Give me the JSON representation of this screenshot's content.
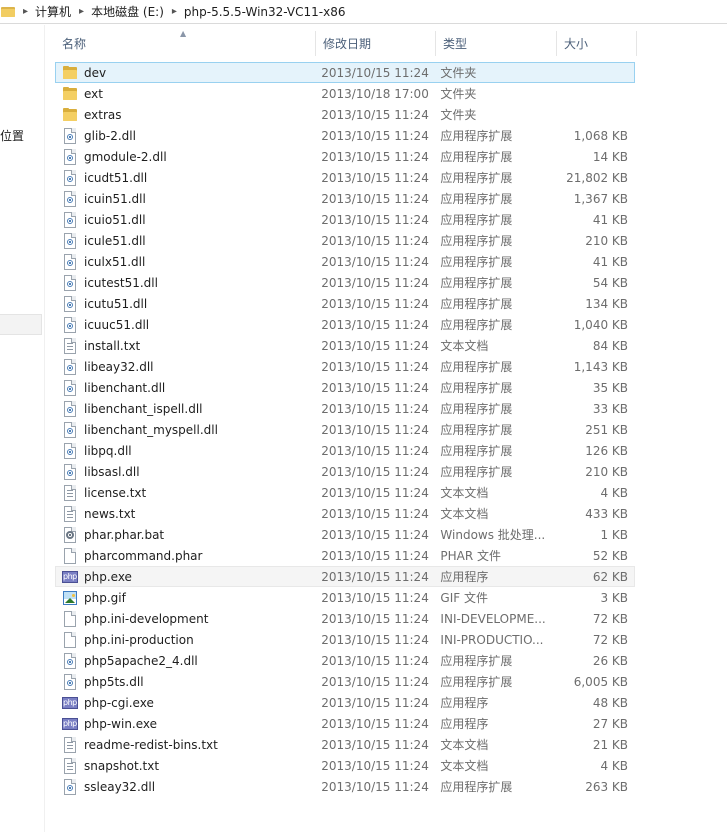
{
  "address_bar": {
    "crumbs": [
      "计算机",
      "本地磁盘 (E:)",
      "php-5.5.5-Win32-VC11-x86"
    ]
  },
  "nav_pane": {
    "partial_label": "位置"
  },
  "columns": {
    "name": "名称",
    "date": "修改日期",
    "type": "类型",
    "size": "大小"
  },
  "files": [
    {
      "name": "dev",
      "date": "2013/10/15 11:24",
      "type": "文件夹",
      "size": "",
      "icon": "folder-icon"
    },
    {
      "name": "ext",
      "date": "2013/10/18 17:00",
      "type": "文件夹",
      "size": "",
      "icon": "folder-icon"
    },
    {
      "name": "extras",
      "date": "2013/10/15 11:24",
      "type": "文件夹",
      "size": "",
      "icon": "folder-icon"
    },
    {
      "name": "glib-2.dll",
      "date": "2013/10/15 11:24",
      "type": "应用程序扩展",
      "size": "1,068 KB",
      "icon": "dll-icon"
    },
    {
      "name": "gmodule-2.dll",
      "date": "2013/10/15 11:24",
      "type": "应用程序扩展",
      "size": "14 KB",
      "icon": "dll-icon"
    },
    {
      "name": "icudt51.dll",
      "date": "2013/10/15 11:24",
      "type": "应用程序扩展",
      "size": "21,802 KB",
      "icon": "dll-icon"
    },
    {
      "name": "icuin51.dll",
      "date": "2013/10/15 11:24",
      "type": "应用程序扩展",
      "size": "1,367 KB",
      "icon": "dll-icon"
    },
    {
      "name": "icuio51.dll",
      "date": "2013/10/15 11:24",
      "type": "应用程序扩展",
      "size": "41 KB",
      "icon": "dll-icon"
    },
    {
      "name": "icule51.dll",
      "date": "2013/10/15 11:24",
      "type": "应用程序扩展",
      "size": "210 KB",
      "icon": "dll-icon"
    },
    {
      "name": "iculx51.dll",
      "date": "2013/10/15 11:24",
      "type": "应用程序扩展",
      "size": "41 KB",
      "icon": "dll-icon"
    },
    {
      "name": "icutest51.dll",
      "date": "2013/10/15 11:24",
      "type": "应用程序扩展",
      "size": "54 KB",
      "icon": "dll-icon"
    },
    {
      "name": "icutu51.dll",
      "date": "2013/10/15 11:24",
      "type": "应用程序扩展",
      "size": "134 KB",
      "icon": "dll-icon"
    },
    {
      "name": "icuuc51.dll",
      "date": "2013/10/15 11:24",
      "type": "应用程序扩展",
      "size": "1,040 KB",
      "icon": "dll-icon"
    },
    {
      "name": "install.txt",
      "date": "2013/10/15 11:24",
      "type": "文本文档",
      "size": "84 KB",
      "icon": "text-file-icon"
    },
    {
      "name": "libeay32.dll",
      "date": "2013/10/15 11:24",
      "type": "应用程序扩展",
      "size": "1,143 KB",
      "icon": "dll-icon"
    },
    {
      "name": "libenchant.dll",
      "date": "2013/10/15 11:24",
      "type": "应用程序扩展",
      "size": "35 KB",
      "icon": "dll-icon"
    },
    {
      "name": "libenchant_ispell.dll",
      "date": "2013/10/15 11:24",
      "type": "应用程序扩展",
      "size": "33 KB",
      "icon": "dll-icon"
    },
    {
      "name": "libenchant_myspell.dll",
      "date": "2013/10/15 11:24",
      "type": "应用程序扩展",
      "size": "251 KB",
      "icon": "dll-icon"
    },
    {
      "name": "libpq.dll",
      "date": "2013/10/15 11:24",
      "type": "应用程序扩展",
      "size": "126 KB",
      "icon": "dll-icon"
    },
    {
      "name": "libsasl.dll",
      "date": "2013/10/15 11:24",
      "type": "应用程序扩展",
      "size": "210 KB",
      "icon": "dll-icon"
    },
    {
      "name": "license.txt",
      "date": "2013/10/15 11:24",
      "type": "文本文档",
      "size": "4 KB",
      "icon": "text-file-icon"
    },
    {
      "name": "news.txt",
      "date": "2013/10/15 11:24",
      "type": "文本文档",
      "size": "433 KB",
      "icon": "text-file-icon"
    },
    {
      "name": "phar.phar.bat",
      "date": "2013/10/15 11:24",
      "type": "Windows 批处理...",
      "size": "1 KB",
      "icon": "batch-file-icon"
    },
    {
      "name": "pharcommand.phar",
      "date": "2013/10/15 11:24",
      "type": "PHAR 文件",
      "size": "52 KB",
      "icon": "blank-file-icon"
    },
    {
      "name": "php.exe",
      "date": "2013/10/15 11:24",
      "type": "应用程序",
      "size": "62 KB",
      "icon": "php-exe-icon"
    },
    {
      "name": "php.gif",
      "date": "2013/10/15 11:24",
      "type": "GIF 文件",
      "size": "3 KB",
      "icon": "image-file-icon"
    },
    {
      "name": "php.ini-development",
      "date": "2013/10/15 11:24",
      "type": "INI-DEVELOPME...",
      "size": "72 KB",
      "icon": "blank-file-icon"
    },
    {
      "name": "php.ini-production",
      "date": "2013/10/15 11:24",
      "type": "INI-PRODUCTIO...",
      "size": "72 KB",
      "icon": "blank-file-icon"
    },
    {
      "name": "php5apache2_4.dll",
      "date": "2013/10/15 11:24",
      "type": "应用程序扩展",
      "size": "26 KB",
      "icon": "dll-icon"
    },
    {
      "name": "php5ts.dll",
      "date": "2013/10/15 11:24",
      "type": "应用程序扩展",
      "size": "6,005 KB",
      "icon": "dll-icon"
    },
    {
      "name": "php-cgi.exe",
      "date": "2013/10/15 11:24",
      "type": "应用程序",
      "size": "48 KB",
      "icon": "php-exe-icon"
    },
    {
      "name": "php-win.exe",
      "date": "2013/10/15 11:24",
      "type": "应用程序",
      "size": "27 KB",
      "icon": "php-exe-icon"
    },
    {
      "name": "readme-redist-bins.txt",
      "date": "2013/10/15 11:24",
      "type": "文本文档",
      "size": "21 KB",
      "icon": "text-file-icon"
    },
    {
      "name": "snapshot.txt",
      "date": "2013/10/15 11:24",
      "type": "文本文档",
      "size": "4 KB",
      "icon": "text-file-icon"
    },
    {
      "name": "ssleay32.dll",
      "date": "2013/10/15 11:24",
      "type": "应用程序扩展",
      "size": "263 KB",
      "icon": "dll-icon"
    }
  ],
  "selected_index": 0,
  "hovered_index": 24,
  "exe_icon_text": "php"
}
